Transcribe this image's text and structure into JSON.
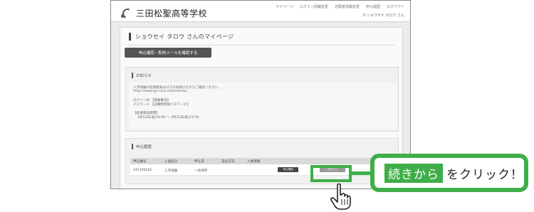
{
  "site": {
    "school_name": "三田松聖高等学校"
  },
  "nav": {
    "items": [
      "マイページ",
      "ログイン情報変更",
      "志願者情報変更",
      "申込履歴",
      "ログアウト"
    ],
    "user_line": "0 ショウセイ タロウ さん"
  },
  "page": {
    "title": "ショウセイ タロウ さんのマイページ",
    "resend_button": "申込確認・配信メールを確認する"
  },
  "notice": {
    "heading": "お知らせ",
    "lines": [
      "入学試験の結果発表は以下のお知らせからご確認ください。",
      "https://www.go-cass.net/sndoshu",
      "ログインID 【受験番号】",
      "パスワード 【志願時登録パスワード】",
      "【結果発表期間】",
      "2月12日(金)16:00 ～ 3月31日(金)23:59"
    ]
  },
  "history": {
    "heading": "申込履歴",
    "columns": [
      "申込番号",
      "入試区分",
      "申込日",
      "支払方法",
      "入金情報"
    ],
    "rows": [
      {
        "number": "241300162",
        "category": "入学試験",
        "date": "一括保存",
        "payment": "-",
        "status": "-",
        "detail_button": "申込確認",
        "continue_button": "続きから"
      }
    ]
  },
  "callout": {
    "highlight_text": "続きから",
    "rest_text": "をクリック！"
  },
  "colors": {
    "accent_green": "#3fae49",
    "dark_button": "#555555"
  }
}
